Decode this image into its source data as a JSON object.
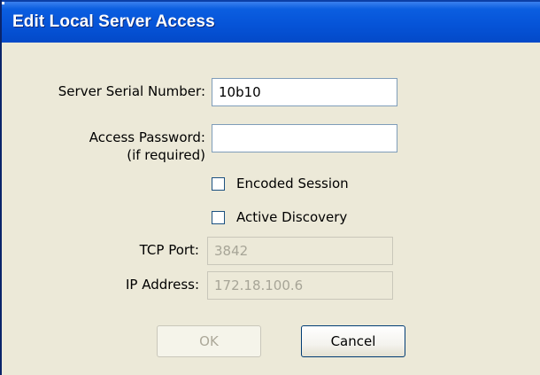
{
  "dialog": {
    "title": "Edit Local Server Access"
  },
  "form": {
    "serial_label": "Server Serial Number:",
    "serial_value": "10b10",
    "password_label": "Access Password:",
    "password_sublabel": "(if required)",
    "password_value": "",
    "encoded_label": "Encoded Session",
    "encoded_checked": false,
    "discovery_label": "Active Discovery",
    "discovery_checked": false,
    "port_label": "TCP Port:",
    "port_value": "3842",
    "ip_label": "IP Address:",
    "ip_value": "172.18.100.6"
  },
  "buttons": {
    "ok_label": "OK",
    "ok_enabled": false,
    "cancel_label": "Cancel"
  }
}
